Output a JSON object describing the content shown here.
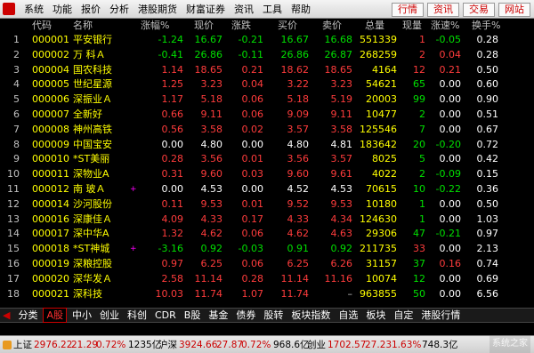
{
  "menu": [
    "系统",
    "功能",
    "报价",
    "分析",
    "港股期货",
    "财富证券",
    "资讯",
    "工具",
    "帮助"
  ],
  "top_buttons": [
    "行情",
    "资讯",
    "交易",
    "网站"
  ],
  "headers": [
    "代码",
    "名称",
    "涨幅%",
    "现价",
    "涨跌",
    "买价",
    "卖价",
    "总量",
    "现量",
    "涨速%",
    "换手%"
  ],
  "rows": [
    {
      "n": "1",
      "code": "000001",
      "name": "平安银行",
      "mark": "",
      "chg": "-1.24",
      "price": "16.67",
      "diff": "-0.21",
      "bid": "16.67",
      "ask": "16.68",
      "vol": "551339",
      "cur": "1",
      "spd": "-0.05",
      "turn": "0.28",
      "d": "dn",
      "cd": "up"
    },
    {
      "n": "2",
      "code": "000002",
      "name": "万 科Ａ",
      "mark": "",
      "chg": "-0.41",
      "price": "26.86",
      "diff": "-0.11",
      "bid": "26.86",
      "ask": "26.87",
      "vol": "268259",
      "cur": "2",
      "spd": "0.04",
      "turn": "0.28",
      "d": "dn",
      "cd": "up"
    },
    {
      "n": "3",
      "code": "000004",
      "name": "国农科技",
      "mark": "",
      "chg": "1.14",
      "price": "18.65",
      "diff": "0.21",
      "bid": "18.62",
      "ask": "18.65",
      "vol": "4164",
      "cur": "12",
      "spd": "0.21",
      "turn": "0.50",
      "d": "up",
      "cd": "up"
    },
    {
      "n": "4",
      "code": "000005",
      "name": "世纪星源",
      "mark": "",
      "chg": "1.25",
      "price": "3.23",
      "diff": "0.04",
      "bid": "3.22",
      "ask": "3.23",
      "vol": "54621",
      "cur": "65",
      "spd": "0.00",
      "turn": "0.60",
      "d": "up",
      "cd": "dn"
    },
    {
      "n": "5",
      "code": "000006",
      "name": "深振业Ａ",
      "mark": "",
      "chg": "1.17",
      "price": "5.18",
      "diff": "0.06",
      "bid": "5.18",
      "ask": "5.19",
      "vol": "20003",
      "cur": "99",
      "spd": "0.00",
      "turn": "0.90",
      "d": "up",
      "cd": "dn"
    },
    {
      "n": "6",
      "code": "000007",
      "name": "全新好",
      "mark": "",
      "chg": "0.66",
      "price": "9.11",
      "diff": "0.06",
      "bid": "9.09",
      "ask": "9.11",
      "vol": "10477",
      "cur": "2",
      "spd": "0.00",
      "turn": "0.51",
      "d": "up",
      "cd": "dn"
    },
    {
      "n": "7",
      "code": "000008",
      "name": "神州高铁",
      "mark": "",
      "chg": "0.56",
      "price": "3.58",
      "diff": "0.02",
      "bid": "3.57",
      "ask": "3.58",
      "vol": "125546",
      "cur": "7",
      "spd": "0.00",
      "turn": "0.67",
      "d": "up",
      "cd": "dn"
    },
    {
      "n": "8",
      "code": "000009",
      "name": "中国宝安",
      "mark": "",
      "chg": "0.00",
      "price": "4.80",
      "diff": "0.00",
      "bid": "4.80",
      "ask": "4.81",
      "vol": "183642",
      "cur": "20",
      "spd": "-0.20",
      "turn": "0.72",
      "d": "fl",
      "cd": "dn"
    },
    {
      "n": "9",
      "code": "000010",
      "name": "*ST美丽",
      "mark": "",
      "chg": "0.28",
      "price": "3.56",
      "diff": "0.01",
      "bid": "3.56",
      "ask": "3.57",
      "vol": "8025",
      "cur": "5",
      "spd": "0.00",
      "turn": "0.42",
      "d": "up",
      "cd": "dn"
    },
    {
      "n": "10",
      "code": "000011",
      "name": "深物业A",
      "mark": "",
      "chg": "0.31",
      "price": "9.60",
      "diff": "0.03",
      "bid": "9.60",
      "ask": "9.61",
      "vol": "4022",
      "cur": "2",
      "spd": "-0.09",
      "turn": "0.15",
      "d": "up",
      "cd": "dn"
    },
    {
      "n": "11",
      "code": "000012",
      "name": "南 玻Ａ",
      "mark": "+",
      "chg": "0.00",
      "price": "4.53",
      "diff": "0.00",
      "bid": "4.52",
      "ask": "4.53",
      "vol": "70615",
      "cur": "10",
      "spd": "-0.22",
      "turn": "0.36",
      "d": "fl",
      "cd": "dn"
    },
    {
      "n": "12",
      "code": "000014",
      "name": "沙河股份",
      "mark": "",
      "chg": "0.11",
      "price": "9.53",
      "diff": "0.01",
      "bid": "9.52",
      "ask": "9.53",
      "vol": "10180",
      "cur": "1",
      "spd": "0.00",
      "turn": "0.50",
      "d": "up",
      "cd": "dn"
    },
    {
      "n": "13",
      "code": "000016",
      "name": "深康佳Ａ",
      "mark": "",
      "chg": "4.09",
      "price": "4.33",
      "diff": "0.17",
      "bid": "4.33",
      "ask": "4.34",
      "vol": "124630",
      "cur": "1",
      "spd": "0.00",
      "turn": "1.03",
      "d": "up",
      "cd": "dn"
    },
    {
      "n": "14",
      "code": "000017",
      "name": "深中华A",
      "mark": "",
      "chg": "1.32",
      "price": "4.62",
      "diff": "0.06",
      "bid": "4.62",
      "ask": "4.63",
      "vol": "29306",
      "cur": "47",
      "spd": "-0.21",
      "turn": "0.97",
      "d": "up",
      "cd": "dn"
    },
    {
      "n": "15",
      "code": "000018",
      "name": "*ST神城",
      "mark": "+",
      "chg": "-3.16",
      "price": "0.92",
      "diff": "-0.03",
      "bid": "0.91",
      "ask": "0.92",
      "vol": "211735",
      "cur": "33",
      "spd": "0.00",
      "turn": "2.13",
      "d": "dn",
      "cd": "up"
    },
    {
      "n": "16",
      "code": "000019",
      "name": "深粮控股",
      "mark": "",
      "chg": "0.97",
      "price": "6.25",
      "diff": "0.06",
      "bid": "6.25",
      "ask": "6.26",
      "vol": "31157",
      "cur": "37",
      "spd": "0.16",
      "turn": "0.74",
      "d": "up",
      "cd": "dn"
    },
    {
      "n": "17",
      "code": "000020",
      "name": "深华发Ａ",
      "mark": "",
      "chg": "2.58",
      "price": "11.14",
      "diff": "0.28",
      "bid": "11.14",
      "ask": "11.16",
      "vol": "10074",
      "cur": "12",
      "spd": "0.00",
      "turn": "0.69",
      "d": "up",
      "cd": "dn"
    },
    {
      "n": "18",
      "code": "000021",
      "name": "深科技",
      "mark": "",
      "chg": "10.03",
      "price": "11.74",
      "diff": "1.07",
      "bid": "11.74",
      "ask": "–",
      "vol": "963855",
      "cur": "50",
      "spd": "0.00",
      "turn": "6.56",
      "d": "up",
      "cd": "dn"
    }
  ],
  "tabs": [
    "分类",
    "A股",
    "中小",
    "创业",
    "科创",
    "CDR",
    "B股",
    "基金",
    "债券",
    "股转",
    "板块指数",
    "自选",
    "板块",
    "自定",
    "港股行情"
  ],
  "status": {
    "sh_label": "上证",
    "sh_val": "2976.22",
    "sh_chg": "21.29",
    "sh_pct": "0.72%",
    "sh_amt": "1235亿",
    "sz_label": "沪深",
    "sz_val": "3924.66",
    "sz_chg": "27.87",
    "sz_pct": "0.72%",
    "sz_amt": "968.6亿",
    "cy_label": "创业",
    "cy_val": "1702.57",
    "cy_chg": "27.23",
    "cy_pct": "1.63%",
    "cy_amt": "748.3亿"
  },
  "watermark": "系统之家"
}
